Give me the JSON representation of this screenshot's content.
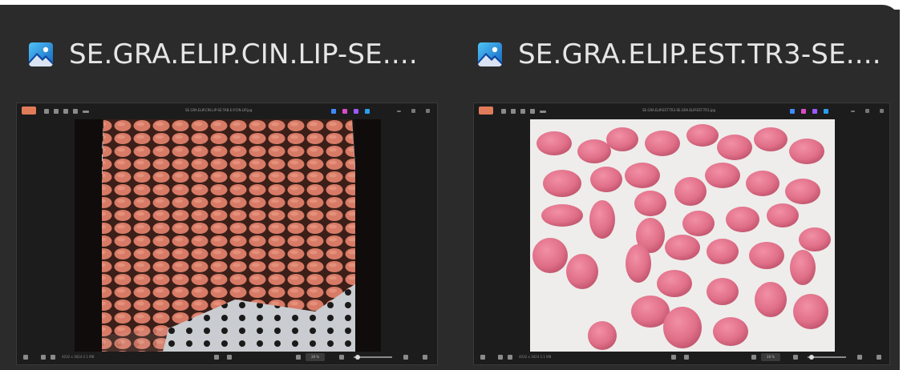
{
  "colors": {
    "background": "#2b2b2b",
    "title_text": "#e6e6e6",
    "edit_button": "#e07b5a",
    "pill_color": "#d77a66",
    "pink_pill_color": "#e06f88"
  },
  "cards": [
    {
      "title": "SE.GRA.ELIP.CIN.LIP-SE....",
      "app_icon": "photos-app-icon",
      "thumbnail": {
        "edit_label": "Edit",
        "window_title": "SE.GRA.ELIP.CIN.LIP-SE.TAB.E.P.CIN.LIP.jpg",
        "status_text": "4032 x 3024  2.1 MB",
        "zoom": "38 %",
        "photo": "orange-elliptical-tablets-on-perforated-tray"
      }
    },
    {
      "title": "SE.GRA.ELIP.EST.TR3-SE....",
      "app_icon": "photos-app-icon",
      "thumbnail": {
        "edit_label": "Edit",
        "window_title": "SE.GRA.ELIP.EST.TR3-SE.GRA.ELIP.EST.TR3.jpg",
        "status_text": "4032 x 3024  2.1 MB",
        "zoom": "38 %",
        "photo": "pink-elliptical-tablets-on-white"
      }
    }
  ]
}
